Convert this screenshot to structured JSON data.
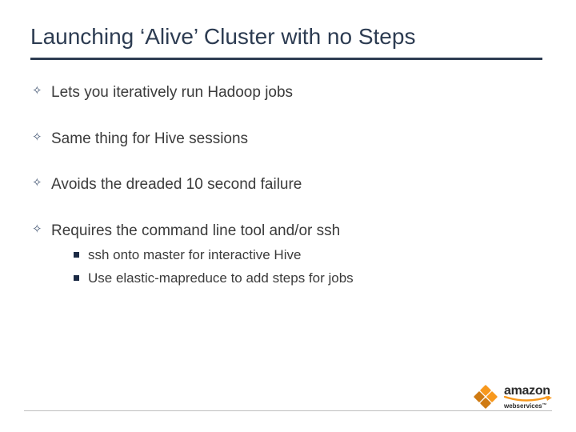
{
  "title": "Launching ‘Alive’ Cluster with no Steps",
  "bullets": [
    {
      "text": "Lets you iteratively run Hadoop jobs"
    },
    {
      "text": "Same thing for Hive sessions"
    },
    {
      "text": "Avoids the dreaded 10 second failure"
    },
    {
      "text": "Requires the command line tool and/or ssh",
      "sub": [
        "ssh onto master for interactive Hive",
        "Use elastic-mapreduce to add steps for jobs"
      ]
    }
  ],
  "logo": {
    "brand": "amazon",
    "sub": "webservices",
    "tm": "™"
  }
}
